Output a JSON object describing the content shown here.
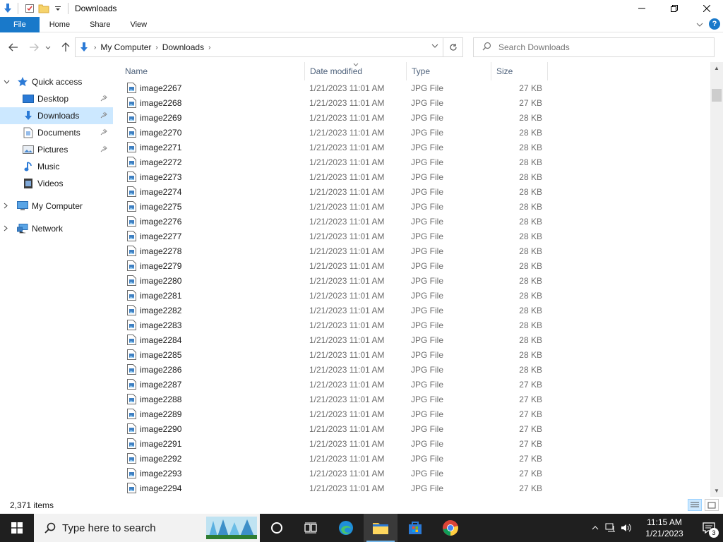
{
  "window": {
    "title": "Downloads",
    "controls": [
      "minimize",
      "maximize",
      "close"
    ]
  },
  "ribbon": {
    "tabs": [
      "File",
      "Home",
      "Share",
      "View"
    ]
  },
  "address": {
    "crumbs": [
      "My Computer",
      "Downloads"
    ],
    "search_placeholder": "Search Downloads"
  },
  "nav": {
    "quick_access": "Quick access",
    "items": [
      {
        "label": "Desktop",
        "icon": "desktop-icon",
        "pinned": true
      },
      {
        "label": "Downloads",
        "icon": "downloads-icon",
        "pinned": true,
        "selected": true
      },
      {
        "label": "Documents",
        "icon": "documents-icon",
        "pinned": true
      },
      {
        "label": "Pictures",
        "icon": "pictures-icon",
        "pinned": true
      },
      {
        "label": "Music",
        "icon": "music-icon",
        "pinned": false
      },
      {
        "label": "Videos",
        "icon": "videos-icon",
        "pinned": false
      }
    ],
    "my_computer": "My Computer",
    "network": "Network"
  },
  "columns": {
    "name": "Name",
    "date": "Date modified",
    "type": "Type",
    "size": "Size"
  },
  "files": [
    {
      "name": "image2267",
      "date": "1/21/2023 11:01 AM",
      "type": "JPG File",
      "size": "27 KB"
    },
    {
      "name": "image2268",
      "date": "1/21/2023 11:01 AM",
      "type": "JPG File",
      "size": "27 KB"
    },
    {
      "name": "image2269",
      "date": "1/21/2023 11:01 AM",
      "type": "JPG File",
      "size": "28 KB"
    },
    {
      "name": "image2270",
      "date": "1/21/2023 11:01 AM",
      "type": "JPG File",
      "size": "28 KB"
    },
    {
      "name": "image2271",
      "date": "1/21/2023 11:01 AM",
      "type": "JPG File",
      "size": "28 KB"
    },
    {
      "name": "image2272",
      "date": "1/21/2023 11:01 AM",
      "type": "JPG File",
      "size": "28 KB"
    },
    {
      "name": "image2273",
      "date": "1/21/2023 11:01 AM",
      "type": "JPG File",
      "size": "28 KB"
    },
    {
      "name": "image2274",
      "date": "1/21/2023 11:01 AM",
      "type": "JPG File",
      "size": "28 KB"
    },
    {
      "name": "image2275",
      "date": "1/21/2023 11:01 AM",
      "type": "JPG File",
      "size": "28 KB"
    },
    {
      "name": "image2276",
      "date": "1/21/2023 11:01 AM",
      "type": "JPG File",
      "size": "28 KB"
    },
    {
      "name": "image2277",
      "date": "1/21/2023 11:01 AM",
      "type": "JPG File",
      "size": "28 KB"
    },
    {
      "name": "image2278",
      "date": "1/21/2023 11:01 AM",
      "type": "JPG File",
      "size": "28 KB"
    },
    {
      "name": "image2279",
      "date": "1/21/2023 11:01 AM",
      "type": "JPG File",
      "size": "28 KB"
    },
    {
      "name": "image2280",
      "date": "1/21/2023 11:01 AM",
      "type": "JPG File",
      "size": "28 KB"
    },
    {
      "name": "image2281",
      "date": "1/21/2023 11:01 AM",
      "type": "JPG File",
      "size": "28 KB"
    },
    {
      "name": "image2282",
      "date": "1/21/2023 11:01 AM",
      "type": "JPG File",
      "size": "28 KB"
    },
    {
      "name": "image2283",
      "date": "1/21/2023 11:01 AM",
      "type": "JPG File",
      "size": "28 KB"
    },
    {
      "name": "image2284",
      "date": "1/21/2023 11:01 AM",
      "type": "JPG File",
      "size": "28 KB"
    },
    {
      "name": "image2285",
      "date": "1/21/2023 11:01 AM",
      "type": "JPG File",
      "size": "28 KB"
    },
    {
      "name": "image2286",
      "date": "1/21/2023 11:01 AM",
      "type": "JPG File",
      "size": "28 KB"
    },
    {
      "name": "image2287",
      "date": "1/21/2023 11:01 AM",
      "type": "JPG File",
      "size": "27 KB"
    },
    {
      "name": "image2288",
      "date": "1/21/2023 11:01 AM",
      "type": "JPG File",
      "size": "27 KB"
    },
    {
      "name": "image2289",
      "date": "1/21/2023 11:01 AM",
      "type": "JPG File",
      "size": "27 KB"
    },
    {
      "name": "image2290",
      "date": "1/21/2023 11:01 AM",
      "type": "JPG File",
      "size": "27 KB"
    },
    {
      "name": "image2291",
      "date": "1/21/2023 11:01 AM",
      "type": "JPG File",
      "size": "27 KB"
    },
    {
      "name": "image2292",
      "date": "1/21/2023 11:01 AM",
      "type": "JPG File",
      "size": "27 KB"
    },
    {
      "name": "image2293",
      "date": "1/21/2023 11:01 AM",
      "type": "JPG File",
      "size": "27 KB"
    },
    {
      "name": "image2294",
      "date": "1/21/2023 11:01 AM",
      "type": "JPG File",
      "size": "27 KB"
    }
  ],
  "status": {
    "item_count": "2,371 items"
  },
  "taskbar": {
    "search_text": "Type here to search",
    "time": "11:15 AM",
    "date": "1/21/2023",
    "notification_count": "3"
  },
  "colors": {
    "accent": "#1979ca",
    "selection": "#cce8ff",
    "taskbar": "#1f1f1f"
  }
}
